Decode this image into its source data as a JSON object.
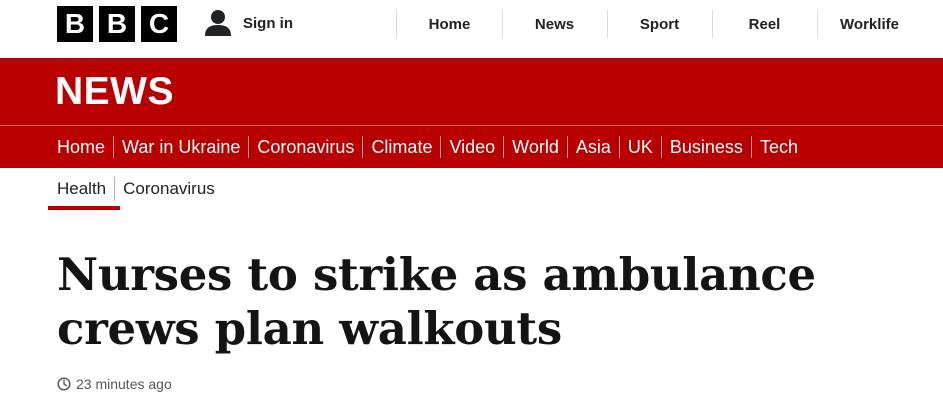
{
  "masthead": {
    "logo_letters": [
      "B",
      "B",
      "C"
    ],
    "signin_label": "Sign in",
    "signin_icon": "user-icon",
    "nav": [
      "Home",
      "News",
      "Sport",
      "Reel",
      "Worklife"
    ]
  },
  "banner": {
    "title": "NEWS",
    "color": "#b80000"
  },
  "section_nav": [
    "Home",
    "War in Ukraine",
    "Coronavirus",
    "Climate",
    "Video",
    "World",
    "Asia",
    "UK",
    "Business",
    "Tech"
  ],
  "sub_nav": {
    "items": [
      "Health",
      "Coronavirus"
    ],
    "active": "Health"
  },
  "article": {
    "headline": "Nurses to strike as ambulance crews plan walkouts",
    "time_icon": "clock-icon",
    "timestamp": "23 minutes ago"
  }
}
